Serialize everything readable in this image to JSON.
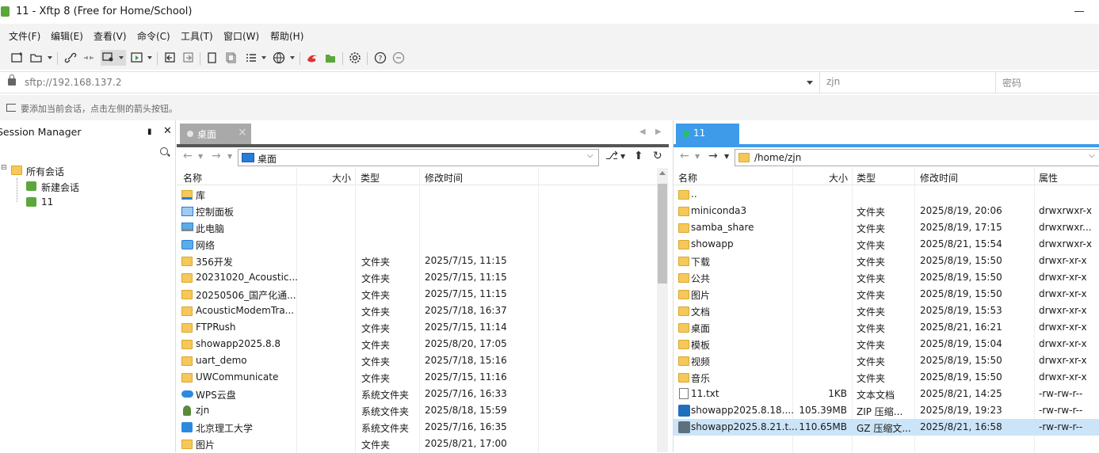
{
  "window": {
    "title": "11 - Xftp 8 (Free for Home/School)"
  },
  "menu": [
    "文件(F)",
    "编辑(E)",
    "查看(V)",
    "命令(C)",
    "工具(T)",
    "窗口(W)",
    "帮助(H)"
  ],
  "address": {
    "url": "sftp://192.168.137.2",
    "username_placeholder": "zjn",
    "password_placeholder": "密码"
  },
  "hint": "要添加当前会话，点击左侧的箭头按钮。",
  "session_manager": {
    "title": "Session Manager",
    "tree": [
      {
        "label": "所有会话",
        "level": 0
      },
      {
        "label": "新建会话",
        "level": 1
      },
      {
        "label": "11",
        "level": 1
      }
    ]
  },
  "left_pane": {
    "tab": "桌面",
    "path": "桌面",
    "columns": [
      "名称",
      "大小",
      "类型",
      "修改时间"
    ],
    "rows": [
      {
        "name": "库",
        "size": "",
        "type": "",
        "modified": "",
        "icon": "library-icon"
      },
      {
        "name": "控制面板",
        "size": "",
        "type": "",
        "modified": "",
        "icon": "control-panel-icon"
      },
      {
        "name": "此电脑",
        "size": "",
        "type": "",
        "modified": "",
        "icon": "computer-icon"
      },
      {
        "name": "网络",
        "size": "",
        "type": "",
        "modified": "",
        "icon": "network-icon"
      },
      {
        "name": "356开发",
        "size": "",
        "type": "文件夹",
        "modified": "2025/7/15, 11:15",
        "icon": "folder-icon"
      },
      {
        "name": "20231020_Acoustic...",
        "size": "",
        "type": "文件夹",
        "modified": "2025/7/15, 11:15",
        "icon": "folder-icon"
      },
      {
        "name": "20250506_国产化通...",
        "size": "",
        "type": "文件夹",
        "modified": "2025/7/15, 11:15",
        "icon": "folder-icon"
      },
      {
        "name": "AcousticModemTra...",
        "size": "",
        "type": "文件夹",
        "modified": "2025/7/18, 16:37",
        "icon": "folder-icon"
      },
      {
        "name": "FTPRush",
        "size": "",
        "type": "文件夹",
        "modified": "2025/7/15, 11:14",
        "icon": "folder-icon"
      },
      {
        "name": "showapp2025.8.8",
        "size": "",
        "type": "文件夹",
        "modified": "2025/8/20, 17:05",
        "icon": "folder-icon"
      },
      {
        "name": "uart_demo",
        "size": "",
        "type": "文件夹",
        "modified": "2025/7/18, 15:16",
        "icon": "folder-icon"
      },
      {
        "name": "UWCommunicate",
        "size": "",
        "type": "文件夹",
        "modified": "2025/7/15, 11:16",
        "icon": "folder-icon"
      },
      {
        "name": "WPS云盘",
        "size": "",
        "type": "系统文件夹",
        "modified": "2025/7/16, 16:33",
        "icon": "cloud-icon"
      },
      {
        "name": "zjn",
        "size": "",
        "type": "系统文件夹",
        "modified": "2025/8/18, 15:59",
        "icon": "user-icon"
      },
      {
        "name": "北京理工大学",
        "size": "",
        "type": "系统文件夹",
        "modified": "2025/7/16, 16:35",
        "icon": "building-icon"
      },
      {
        "name": "图片",
        "size": "",
        "type": "文件夹",
        "modified": "2025/8/21, 17:00",
        "icon": "folder-icon"
      }
    ]
  },
  "right_pane": {
    "tab": "11",
    "path": "/home/zjn",
    "columns": [
      "名称",
      "大小",
      "类型",
      "修改时间",
      "属性"
    ],
    "rows": [
      {
        "name": "..",
        "size": "",
        "type": "",
        "modified": "",
        "perm": "",
        "icon": "folder-icon"
      },
      {
        "name": "miniconda3",
        "size": "",
        "type": "文件夹",
        "modified": "2025/8/19, 20:06",
        "perm": "drwxrwxr-x",
        "icon": "folder-icon"
      },
      {
        "name": "samba_share",
        "size": "",
        "type": "文件夹",
        "modified": "2025/8/19, 17:15",
        "perm": "drwxrwxr...",
        "icon": "folder-icon"
      },
      {
        "name": "showapp",
        "size": "",
        "type": "文件夹",
        "modified": "2025/8/21, 15:54",
        "perm": "drwxrwxr-x",
        "icon": "folder-icon"
      },
      {
        "name": "下载",
        "size": "",
        "type": "文件夹",
        "modified": "2025/8/19, 15:50",
        "perm": "drwxr-xr-x",
        "icon": "folder-icon"
      },
      {
        "name": "公共",
        "size": "",
        "type": "文件夹",
        "modified": "2025/8/19, 15:50",
        "perm": "drwxr-xr-x",
        "icon": "folder-icon"
      },
      {
        "name": "图片",
        "size": "",
        "type": "文件夹",
        "modified": "2025/8/19, 15:50",
        "perm": "drwxr-xr-x",
        "icon": "folder-icon"
      },
      {
        "name": "文档",
        "size": "",
        "type": "文件夹",
        "modified": "2025/8/19, 15:53",
        "perm": "drwxr-xr-x",
        "icon": "folder-icon"
      },
      {
        "name": "桌面",
        "size": "",
        "type": "文件夹",
        "modified": "2025/8/21, 16:21",
        "perm": "drwxr-xr-x",
        "icon": "folder-icon"
      },
      {
        "name": "模板",
        "size": "",
        "type": "文件夹",
        "modified": "2025/8/19, 15:04",
        "perm": "drwxr-xr-x",
        "icon": "folder-icon"
      },
      {
        "name": "视频",
        "size": "",
        "type": "文件夹",
        "modified": "2025/8/19, 15:50",
        "perm": "drwxr-xr-x",
        "icon": "folder-icon"
      },
      {
        "name": "音乐",
        "size": "",
        "type": "文件夹",
        "modified": "2025/8/19, 15:50",
        "perm": "drwxr-xr-x",
        "icon": "folder-icon"
      },
      {
        "name": "11.txt",
        "size": "1KB",
        "type": "文本文档",
        "modified": "2025/8/21, 14:25",
        "perm": "-rw-rw-r--",
        "icon": "text-file-icon"
      },
      {
        "name": "showapp2025.8.18....",
        "size": "105.39MB",
        "type": "ZIP 压缩...",
        "modified": "2025/8/19, 19:23",
        "perm": "-rw-rw-r--",
        "icon": "zip-file-icon"
      },
      {
        "name": "showapp2025.8.21.t...",
        "size": "110.65MB",
        "type": "GZ 压缩文...",
        "modified": "2025/8/21, 16:58",
        "perm": "-rw-rw-r--",
        "icon": "gz-file-icon",
        "selected": true
      }
    ]
  }
}
